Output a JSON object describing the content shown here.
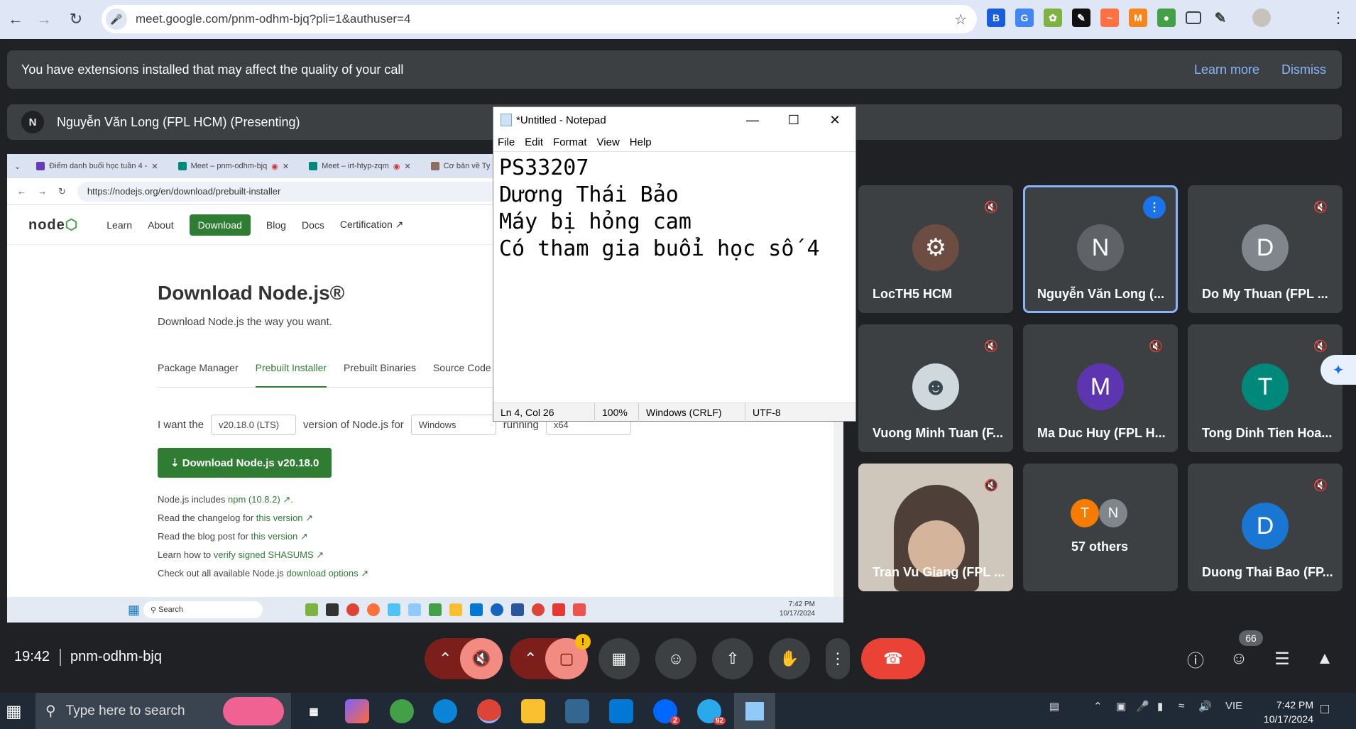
{
  "browser": {
    "url": "meet.google.com/pnm-odhm-bjq?pli=1&authuser=4"
  },
  "banner": {
    "message": "You have extensions installed that may affect the quality of your call",
    "learn_more": "Learn more",
    "dismiss": "Dismiss"
  },
  "presenter": {
    "initial": "N",
    "label": "Nguyễn Văn Long (FPL HCM) (Presenting)"
  },
  "shared_screen": {
    "tabs": [
      "Điểm danh buổi học tuần 4 -",
      "Meet – pnm-odhm-bjq",
      "Meet – irt-htyp-zqm",
      "Cơ bản về Ty"
    ],
    "address": "https://nodejs.org/en/download/prebuilt-installer",
    "nav": [
      "Learn",
      "About",
      "Download",
      "Blog",
      "Docs",
      "Certification ↗"
    ],
    "heading": "Download Node.js®",
    "subheading": "Download Node.js the way you want.",
    "subtabs": [
      "Package Manager",
      "Prebuilt Installer",
      "Prebuilt Binaries",
      "Source Code"
    ],
    "form": {
      "i_want": "I want the",
      "version": "v20.18.0 (LTS)",
      "version_of": "version of Node.js for",
      "os": "Windows",
      "running": "running",
      "arch": "x64"
    },
    "download_button": "Download Node.js v20.18.0",
    "links": [
      {
        "text": "Node.js includes ",
        "link": "npm (10.8.2) ↗."
      },
      {
        "text": "Read the changelog for ",
        "link": "this version ↗"
      },
      {
        "text": "Read the blog post for ",
        "link": "this version ↗"
      },
      {
        "text": "Learn how to ",
        "link": "verify signed SHASUMS ↗"
      },
      {
        "text": "Check out all available Node.js ",
        "link": "download options ↗"
      }
    ],
    "taskbar_search": "Search",
    "clock_time": "7:42 PM",
    "clock_date": "10/17/2024"
  },
  "notepad": {
    "title": "*Untitled - Notepad",
    "menu": [
      "File",
      "Edit",
      "Format",
      "View",
      "Help"
    ],
    "content": "PS33207\nDương Thái Bảo\nMáy bị hỏng cam\nCó tham gia buổi học số 4",
    "status": {
      "position": "Ln 4, Col 26",
      "zoom": "100%",
      "line_ending": "Windows (CRLF)",
      "encoding": "UTF-8"
    }
  },
  "participants": [
    {
      "name": "LocTH5 HCM",
      "initial": "",
      "color": "#6d4c41",
      "muted": true
    },
    {
      "name": "Nguyễn Văn Long (...",
      "initial": "N",
      "color": "#5f6368",
      "muted": false,
      "speaking": true
    },
    {
      "name": "Do My Thuan (FPL ...",
      "initial": "D",
      "color": "#80868b",
      "muted": true
    },
    {
      "name": "Vuong Minh Tuan (F...",
      "initial": "",
      "color": "#b0bec5",
      "muted": true
    },
    {
      "name": "Ma Duc Huy (FPL H...",
      "initial": "M",
      "color": "#5e35b1",
      "muted": true
    },
    {
      "name": "Tong Dinh Tien Hoa...",
      "initial": "T",
      "color": "#00897b",
      "muted": true
    },
    {
      "name": "Tran Vu Giang (FPL ...",
      "initial": "",
      "color": "#8d7b6a",
      "muted": true
    },
    {
      "name": "57 others",
      "initial": "",
      "color": "",
      "muted": false
    },
    {
      "name": "Duong Thai Bao (FP...",
      "initial": "D",
      "color": "#1976d2",
      "muted": true
    }
  ],
  "others_avatars": [
    "T",
    "N"
  ],
  "meeting": {
    "time": "19:42",
    "code": "pnm-odhm-bjq",
    "people_count": "66"
  },
  "windows_taskbar": {
    "search_placeholder": "Type here to search",
    "language": "VIE",
    "time": "7:42 PM",
    "date": "10/17/2024",
    "zalo_badge": "2",
    "telegram_badge": "92"
  }
}
